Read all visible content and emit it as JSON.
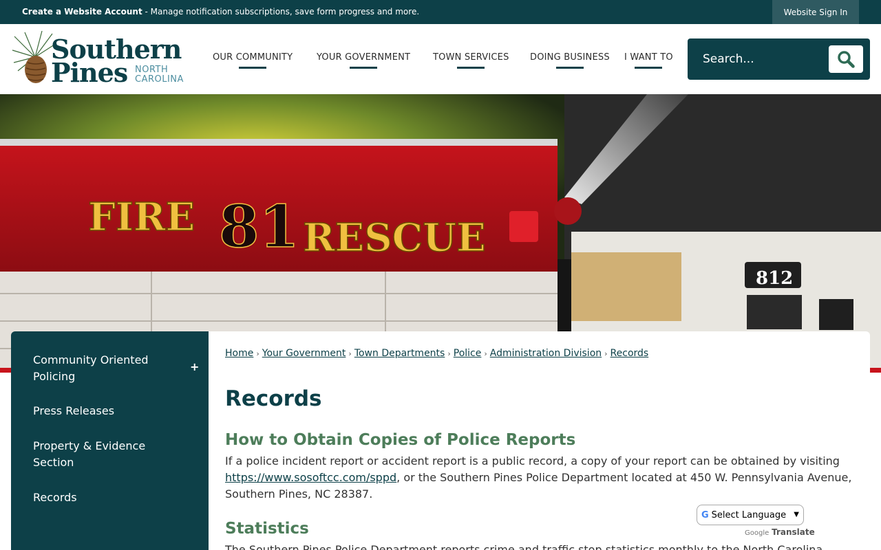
{
  "topbar": {
    "account_title": "Create a Website Account",
    "account_text": " - Manage notification subscriptions, save form progress and more.",
    "sign_in": "Website Sign In"
  },
  "logo": {
    "line1": "Southern",
    "line2": "Pines",
    "state_line1": "NORTH",
    "state_line2": "CAROLINA"
  },
  "nav": {
    "items": [
      {
        "label": "OUR COMMUNITY"
      },
      {
        "label": "YOUR GOVERNMENT"
      },
      {
        "label": "TOWN SERVICES"
      },
      {
        "label": "DOING BUSINESS"
      },
      {
        "label": "I WANT TO"
      }
    ]
  },
  "search": {
    "placeholder": "Search...",
    "icon": "search-icon"
  },
  "hero": {
    "truck_text_left": "FIRE",
    "truck_number": "81",
    "truck_text_right": "RESCUE",
    "second_truck_number": "812"
  },
  "sidebar": {
    "items": [
      {
        "label_line1": "Community Oriented",
        "label_line2": "Policing",
        "expand": "+"
      },
      {
        "label_line1": "Press Releases"
      },
      {
        "label_line1": "Property & Evidence",
        "label_line2": "Section"
      },
      {
        "label_line1": "Records"
      }
    ]
  },
  "breadcrumb": {
    "items": [
      "Home",
      "Your Government",
      "Town Departments",
      "Police",
      "Administration Division",
      "Records"
    ],
    "separator": "›"
  },
  "main": {
    "title": "Records",
    "section1": {
      "heading": "How to Obtain Copies of Police Reports",
      "text_before_link": "If a police incident report or accident report is a public record, a copy of your report can be obtained by visiting ",
      "link": "https://www.sosoftcc.com/sppd",
      "text_after_link": ", or the Southern Pines Police Department located at 450 W. Pennsylvania Avenue, Southern Pines, NC  28387."
    },
    "section2": {
      "heading": "Statistics",
      "text": "The Southern Pines Police Department reports crime and traffic stop statistics monthly to the North Carolina"
    }
  },
  "translate": {
    "select_label": "Select Language",
    "powered_by": "Google",
    "translate_label": "Translate"
  }
}
